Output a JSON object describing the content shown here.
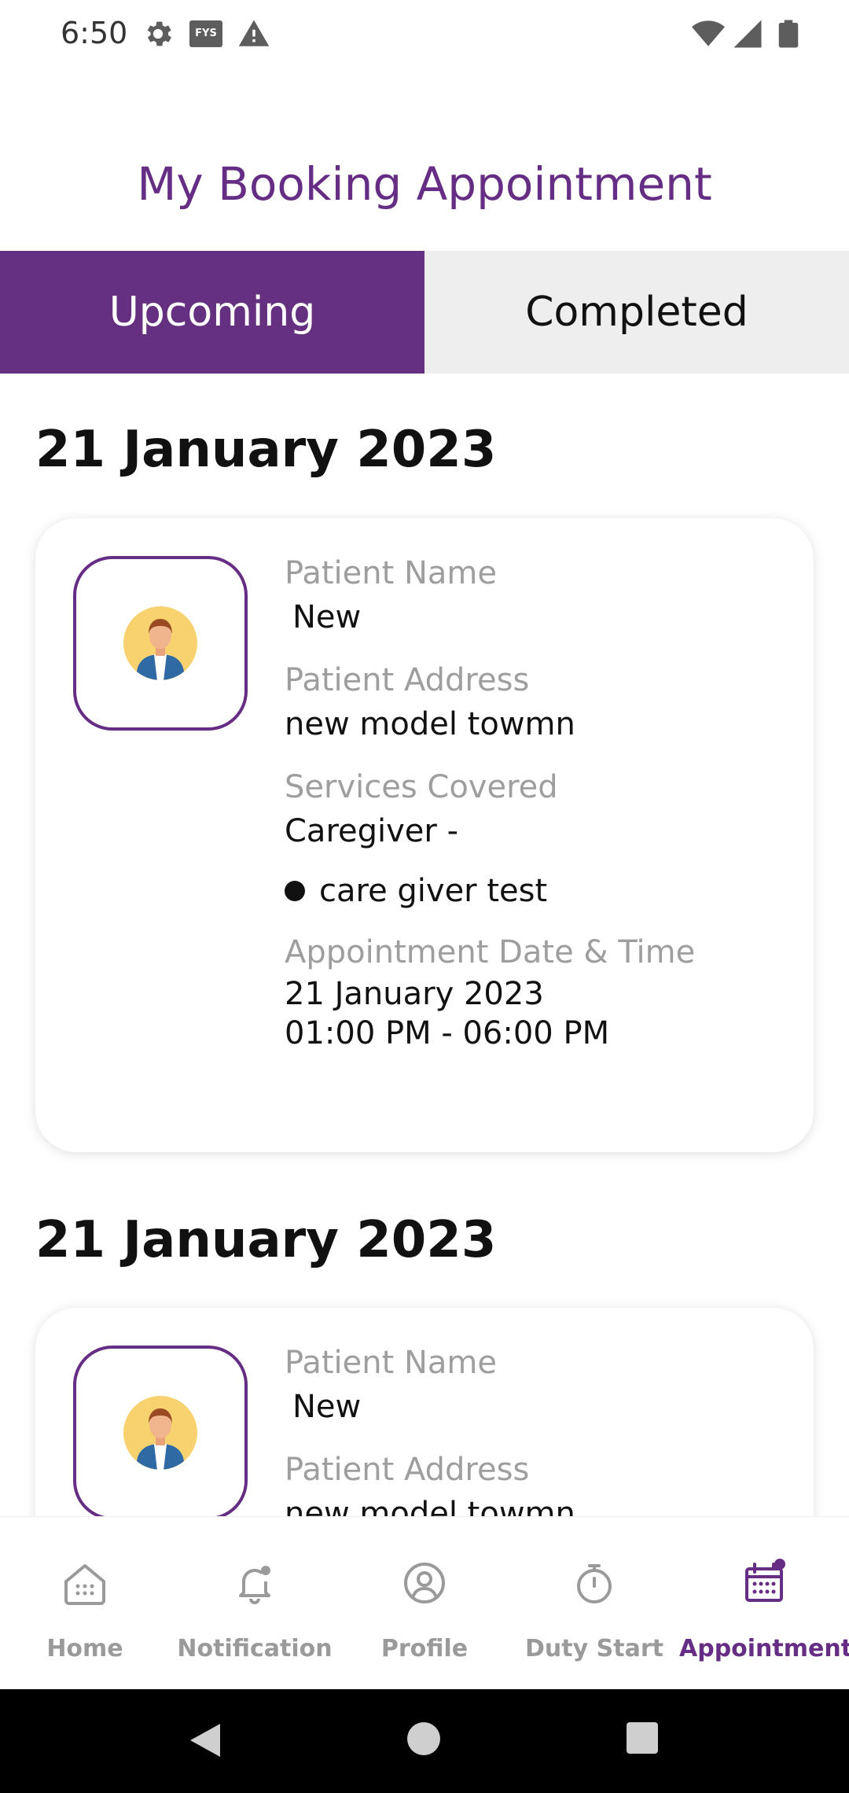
{
  "status_bar": {
    "time": "6:50",
    "fys_badge": "FYS",
    "icons": [
      "gear-icon",
      "fys-icon",
      "alert-icon",
      "wifi-icon",
      "signal-icon",
      "battery-icon"
    ]
  },
  "header": {
    "title": "My Booking Appointment"
  },
  "tabs": [
    {
      "label": "Upcoming",
      "active": true
    },
    {
      "label": "Completed",
      "active": false
    }
  ],
  "appointments": [
    {
      "date_heading": "21 January 2023",
      "patient_name_label": "Patient Name",
      "patient_name": "New",
      "patient_address_label": "Patient Address",
      "patient_address": "new model towmn",
      "services_label": "Services Covered",
      "service_category": "Caregiver -",
      "service_item": "care giver test",
      "datetime_label": "Appointment Date & Time",
      "date": "21 January 2023",
      "time_range": "01:00 PM - 06:00 PM"
    },
    {
      "date_heading": "21 January 2023",
      "patient_name_label": "Patient Name",
      "patient_name": "New",
      "patient_address_label": "Patient Address",
      "patient_address": "new model towmn"
    }
  ],
  "bottom_nav": [
    {
      "label": "Home",
      "icon": "home-icon",
      "active": false
    },
    {
      "label": "Notification",
      "icon": "bell-icon",
      "active": false
    },
    {
      "label": "Profile",
      "icon": "profile-icon",
      "active": false
    },
    {
      "label": "Duty Start",
      "icon": "stopwatch-icon",
      "active": false
    },
    {
      "label": "Appointment",
      "icon": "calendar-icon",
      "active": true
    }
  ],
  "colors": {
    "brand": "#662d84",
    "tab_active_bg": "#65307f",
    "tab_inactive_bg": "#eeeeee",
    "label_gray": "#9e9e9e",
    "nav_inactive": "#9a9a9a"
  }
}
